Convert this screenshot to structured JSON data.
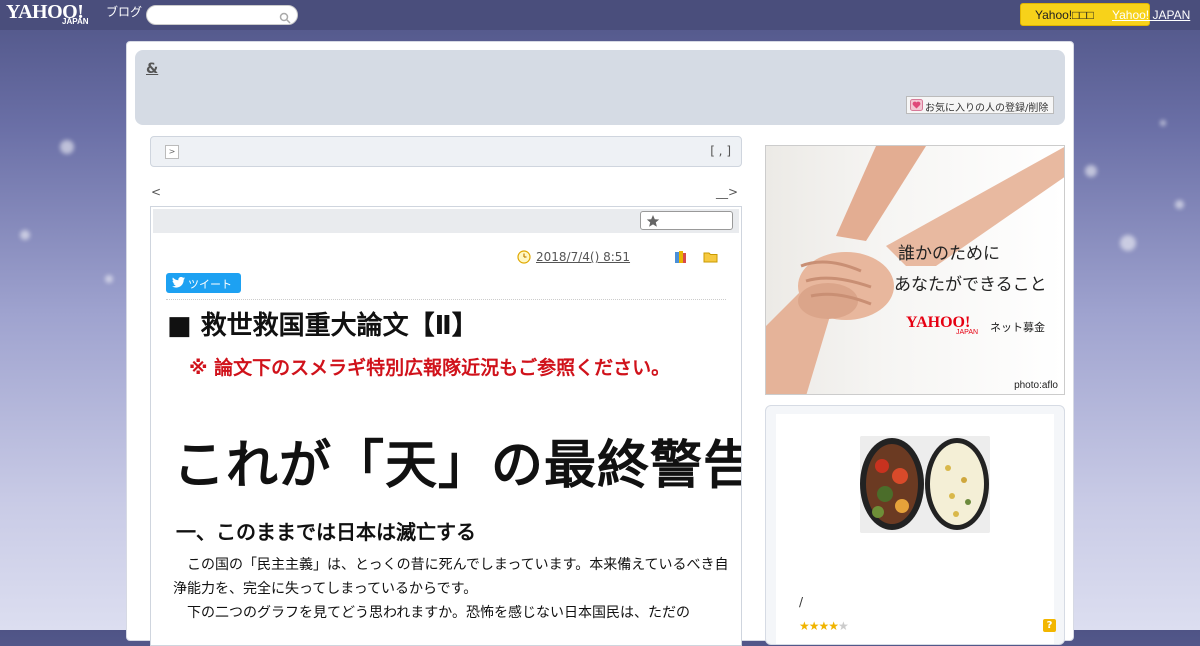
{
  "topbar": {
    "logo_text": "YAHOO!",
    "logo_sub": "JAPAN",
    "blog_label": "ブログ",
    "search_placeholder": "",
    "yellow_button_label": "Yahoo!□□□",
    "yahoo_japan_link": "Yahoo! JAPAN"
  },
  "blog": {
    "title": "&",
    "fav_button_label": "お気に入りの人の登録/削除"
  },
  "category_bar": {
    "right_text": "[ , ]"
  },
  "nav": {
    "prev": "<",
    "next": "__>"
  },
  "article": {
    "date": "2018/7/4()  8:51   ",
    "tweet_label": "ツイート",
    "heading": "■ 救世救国重大論文【Ⅱ】",
    "note": "※ 論文下のスメラギ特別広報隊近況もご参照ください。",
    "big_title": "これが「天」の最終警告だ",
    "subheading": "一、このままでは日本は滅亡する",
    "paragraphs": [
      "この国の「民主主義」は、とっくの昔に死んでしまっています。本来備えているべき自浄能力を、完全に失ってしまっているからです。",
      "下の二つのグラフを見てどう思われますか。恐怖を感じない日本国民は、ただの"
    ]
  },
  "ad": {
    "line1": "誰かのために",
    "line2": "あなたができること",
    "brand": "YAHOO!",
    "brand_sub": "JAPAN",
    "service": "ネット募金",
    "credit": "photo:aflo"
  },
  "profile": {
    "separator": "/",
    "rating_filled": "★★★★",
    "rating_empty": "★",
    "rating_stars": 4,
    "rating_max": 5,
    "help_label": "?"
  },
  "colors": {
    "topbar": "#4a4e7c",
    "accent_yellow": "#f7d21a",
    "note_red": "#d0121b",
    "tweet_blue": "#1da1f2"
  },
  "icons": [
    "search-icon",
    "heart-icon",
    "star-icon",
    "clock-icon",
    "book-icon",
    "folder-icon",
    "twitter-bird-icon",
    "help-icon"
  ]
}
